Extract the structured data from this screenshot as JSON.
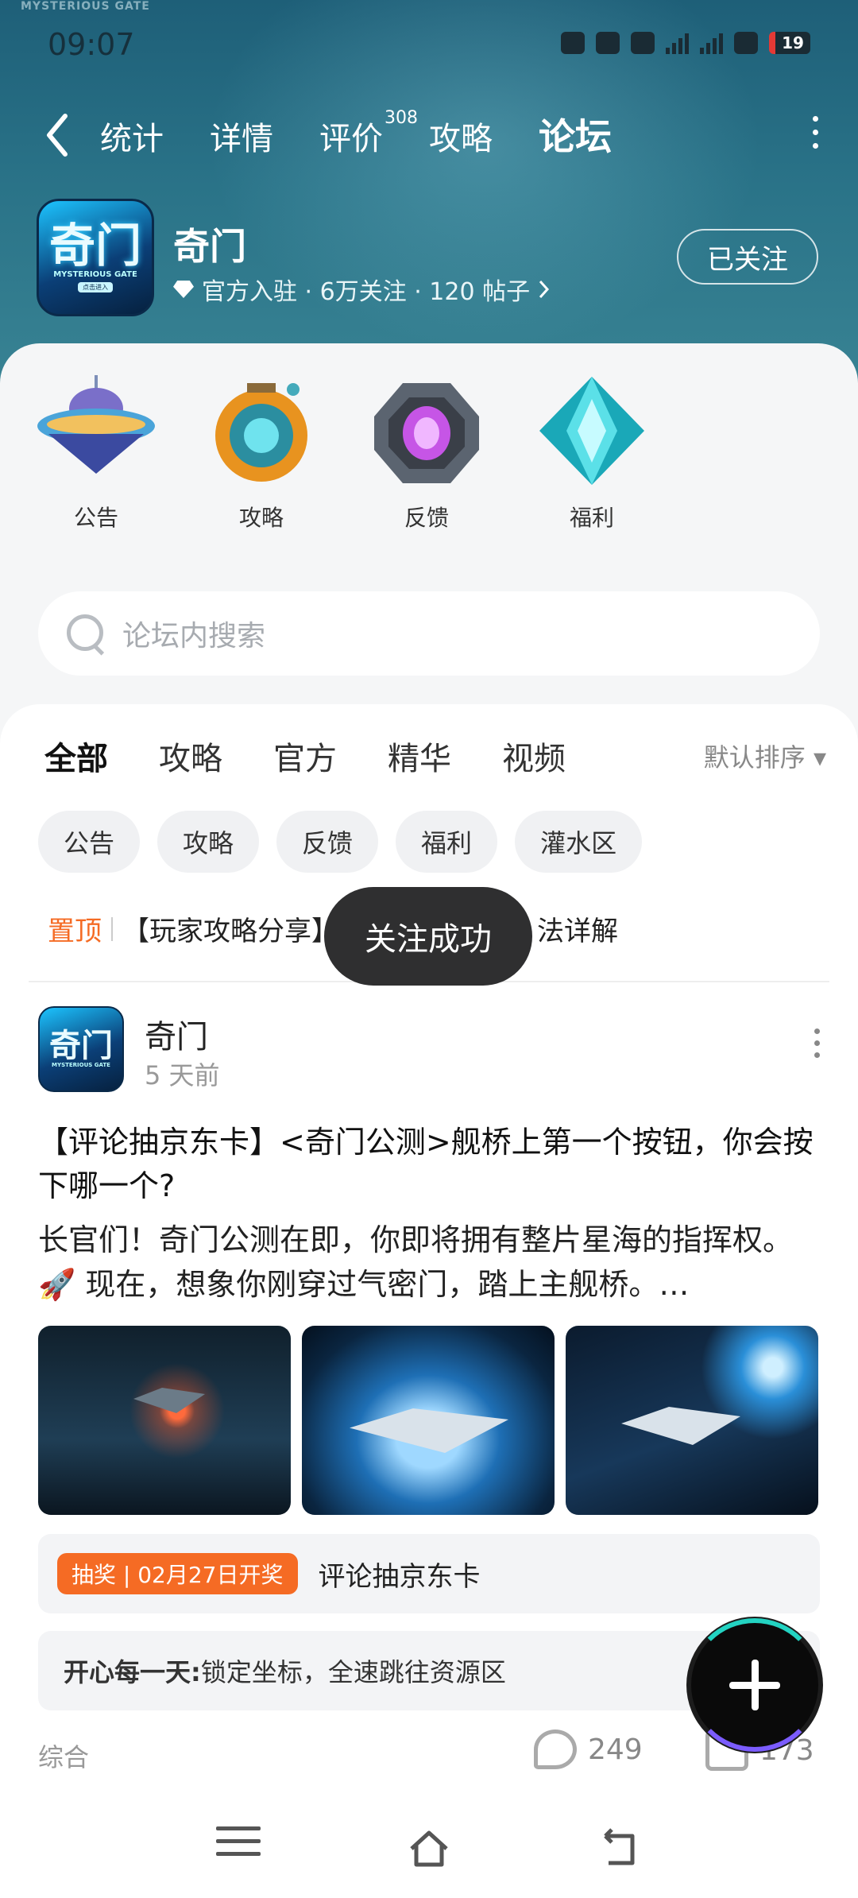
{
  "status_bar": {
    "time": "09:07",
    "battery": "19"
  },
  "hero": {
    "watermark": "MYSTERIOUS GATE"
  },
  "nav": {
    "tabs": [
      {
        "label": "统计"
      },
      {
        "label": "详情"
      },
      {
        "label": "评价",
        "badge": "308"
      },
      {
        "label": "攻略"
      },
      {
        "label": "论坛"
      }
    ],
    "active_tab": "论坛"
  },
  "forum": {
    "logo_text": "奇门",
    "logo_sub": "MYSTERIOUS GATE",
    "logo_btn": "点击进入",
    "name": "奇门",
    "meta": "官方入驻 · 6万关注 · 120 帖子",
    "follow_label": "已关注"
  },
  "quick_entries": [
    {
      "label": "公告",
      "icon": "ufo-icon"
    },
    {
      "label": "攻略",
      "icon": "robot-pod-icon"
    },
    {
      "label": "反馈",
      "icon": "purple-gem-icon"
    },
    {
      "label": "福利",
      "icon": "cyan-crystal-icon"
    }
  ],
  "search": {
    "placeholder": "论坛内搜索"
  },
  "filter_tabs": [
    "全部",
    "攻略",
    "官方",
    "精华",
    "视频"
  ],
  "sort_label": "默认排序",
  "chips": [
    "公告",
    "攻略",
    "反馈",
    "福利",
    "灌水区"
  ],
  "pinned": {
    "tag": "置顶",
    "text": "【玩家攻略分享】…法详解",
    "text_left": "【玩家攻略分享】",
    "text_right": "法详解"
  },
  "toast": "关注成功",
  "post": {
    "author": "奇门",
    "time": "5 天前",
    "title": "【评论抽京东卡】<奇门公测>舰桥上第一个按钮，你会按下哪一个?",
    "body": "长官们！奇门公测在即，你即将拥有整片星海的指挥权。🚀 现在，想象你刚穿过气密门，踏上主舰桥。…",
    "lottery_tag": "抽奖 | 02月27日开奖",
    "lottery_text": "评论抽京东卡",
    "top_comment_name": "开心每一天:",
    "top_comment_text": "锁定坐标，全速跳往资源区",
    "category": "综合",
    "comments": "249",
    "likes": "173"
  },
  "colors": {
    "accent": "#1fd1c0",
    "orange": "#f56b24",
    "hero": "#2a7388"
  }
}
